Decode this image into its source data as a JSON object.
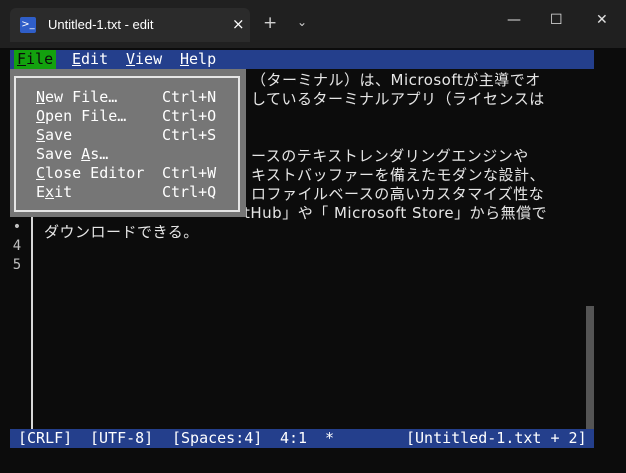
{
  "window": {
    "tab_title": "Untitled-1.txt - edit",
    "tab_close": "×",
    "new_tab": "+",
    "tab_dropdown": "⌄",
    "minimize": "—",
    "maximize": "☐",
    "close": "✕"
  },
  "menubar": {
    "items": [
      {
        "first": "F",
        "rest": "ile"
      },
      {
        "first": "E",
        "rest": "dit"
      },
      {
        "first": "V",
        "rest": "iew"
      },
      {
        "first": "H",
        "rest": "elp"
      }
    ]
  },
  "file_menu": {
    "items": [
      {
        "first": "N",
        "rest": "ew File…",
        "shortcut": "Ctrl+N"
      },
      {
        "first": "O",
        "rest": "pen File…",
        "shortcut": "Ctrl+O"
      },
      {
        "first": "S",
        "rest": "ave",
        "shortcut": "Ctrl+S"
      },
      {
        "pre": "Save ",
        "first": "A",
        "rest": "s…",
        "shortcut": ""
      },
      {
        "first": "C",
        "rest": "lose Editor",
        "shortcut": "Ctrl+W"
      },
      {
        "pre": "E",
        "first": "x",
        "rest": "it",
        "shortcut": "Ctrl+Q"
      }
    ]
  },
  "editor": {
    "gutter": [
      "•",
      "4",
      "5"
    ],
    "lines": [
      "（ターミナル）は、Microsoftが主導でオ",
      "しているターミナルアプリ（ライセンスは",
      "",
      "ースのテキストレンダリングエンジンや",
      "キストバッファーを備えたモダンな設計、",
      "ロファイルベースの高いカスタマイズ性な",
      "tHub」や「 Microsoft Store」から無償で",
      "ダウンロードできる。"
    ]
  },
  "statusbar": {
    "eol": "[CRLF]",
    "encoding": "[UTF-8]",
    "indent": "[Spaces:4]",
    "position": "4:1",
    "modified": "*",
    "file": "[Untitled-1.txt + 2]"
  }
}
